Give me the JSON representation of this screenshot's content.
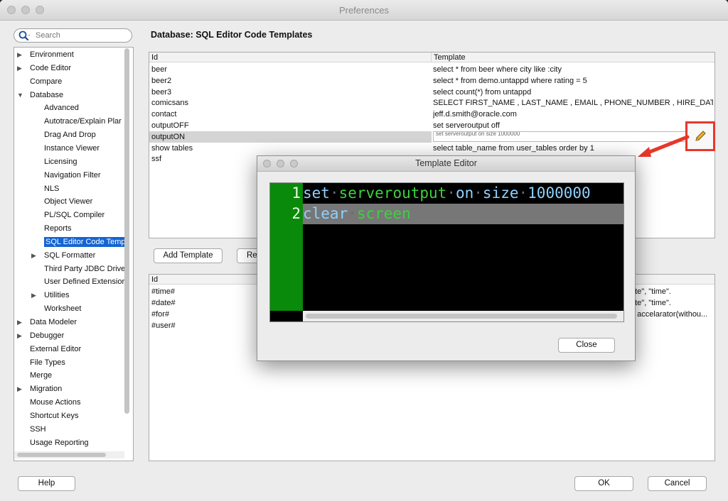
{
  "window": {
    "title": "Preferences"
  },
  "search": {
    "placeholder": "Search"
  },
  "tree": {
    "items": [
      {
        "label": "Environment",
        "expandable": true,
        "expanded": false,
        "level": 0
      },
      {
        "label": "Code Editor",
        "expandable": true,
        "expanded": false,
        "level": 0
      },
      {
        "label": "Compare",
        "expandable": false,
        "level": 0
      },
      {
        "label": "Database",
        "expandable": true,
        "expanded": true,
        "level": 0
      },
      {
        "label": "Advanced",
        "expandable": false,
        "level": 1
      },
      {
        "label": "Autotrace/Explain Plar",
        "expandable": false,
        "level": 1
      },
      {
        "label": "Drag And Drop",
        "expandable": false,
        "level": 1
      },
      {
        "label": "Instance Viewer",
        "expandable": false,
        "level": 1
      },
      {
        "label": "Licensing",
        "expandable": false,
        "level": 1
      },
      {
        "label": "Navigation Filter",
        "expandable": false,
        "level": 1
      },
      {
        "label": "NLS",
        "expandable": false,
        "level": 1
      },
      {
        "label": "Object Viewer",
        "expandable": false,
        "level": 1
      },
      {
        "label": "PL/SQL Compiler",
        "expandable": false,
        "level": 1
      },
      {
        "label": "Reports",
        "expandable": false,
        "level": 1
      },
      {
        "label": "SQL Editor Code Templ",
        "expandable": false,
        "level": 1,
        "selected": true
      },
      {
        "label": "SQL Formatter",
        "expandable": true,
        "expanded": false,
        "level": 1
      },
      {
        "label": "Third Party JDBC Driver",
        "expandable": false,
        "level": 1
      },
      {
        "label": "User Defined Extensior",
        "expandable": false,
        "level": 1
      },
      {
        "label": "Utilities",
        "expandable": true,
        "expanded": false,
        "level": 1
      },
      {
        "label": "Worksheet",
        "expandable": false,
        "level": 1
      },
      {
        "label": "Data Modeler",
        "expandable": true,
        "expanded": false,
        "level": 0
      },
      {
        "label": "Debugger",
        "expandable": true,
        "expanded": false,
        "level": 0
      },
      {
        "label": "External Editor",
        "expandable": false,
        "level": 0
      },
      {
        "label": "File Types",
        "expandable": false,
        "level": 0
      },
      {
        "label": "Merge",
        "expandable": false,
        "level": 0
      },
      {
        "label": "Migration",
        "expandable": true,
        "expanded": false,
        "level": 0
      },
      {
        "label": "Mouse Actions",
        "expandable": false,
        "level": 0
      },
      {
        "label": "Shortcut Keys",
        "expandable": false,
        "level": 0
      },
      {
        "label": "SSH",
        "expandable": false,
        "level": 0
      },
      {
        "label": "Usage Reporting",
        "expandable": false,
        "level": 0
      }
    ]
  },
  "panel": {
    "title": "Database: SQL Editor Code Templates",
    "templates_table": {
      "headers": [
        "Id",
        "Template"
      ],
      "rows": [
        {
          "id": "beer",
          "template": "select * from beer where city like :city"
        },
        {
          "id": "beer2",
          "template": "select * from demo.untappd where rating = 5"
        },
        {
          "id": "beer3",
          "template": "select count(*) from untappd"
        },
        {
          "id": "comicsans",
          "template": "SELECT FIRST_NAME , LAST_NAME , EMAIL , PHONE_NUMBER , HIRE_DATE , JOB_ID..."
        },
        {
          "id": "contact",
          "template": "jeff.d.smith@oracle.com"
        },
        {
          "id": "outputOFF",
          "template": "set serveroutput off"
        },
        {
          "id": "outputON",
          "template": "set serveroutput on size 1000000",
          "selected": true
        },
        {
          "id": "show tables",
          "template": "select table_name from user_tables order by 1"
        },
        {
          "id": "ssf",
          "template": ""
        }
      ]
    },
    "add_template_label": "Add Template",
    "remove_template_label": "Re",
    "vars_table": {
      "headers": [
        "Id"
      ],
      "rows": [
        {
          "id": "#time#",
          "tail": "ate\", \"time\"."
        },
        {
          "id": "#date#",
          "tail": "ate\", \"time\"."
        },
        {
          "id": "#for#",
          "tail": "e accelarator(withou..."
        },
        {
          "id": "#user#",
          "tail": ""
        }
      ]
    }
  },
  "dialog": {
    "title": "Template Editor",
    "lines": [
      {
        "number": "1",
        "tokens": [
          {
            "t": "set",
            "c": "kw"
          },
          {
            "t": "·",
            "c": "ws"
          },
          {
            "t": "serveroutput",
            "c": "gr"
          },
          {
            "t": "·",
            "c": "ws"
          },
          {
            "t": "on",
            "c": "kw"
          },
          {
            "t": "·",
            "c": "ws"
          },
          {
            "t": "size",
            "c": "kw"
          },
          {
            "t": "·",
            "c": "ws"
          },
          {
            "t": "1000000",
            "c": "kw"
          }
        ]
      },
      {
        "number": "2",
        "tokens": [
          {
            "t": "clear",
            "c": "kw"
          },
          {
            "t": "·",
            "c": "ws"
          },
          {
            "t": "screen",
            "c": "gr"
          }
        ]
      }
    ],
    "close_label": "Close"
  },
  "footer": {
    "help_label": "Help",
    "ok_label": "OK",
    "cancel_label": "Cancel"
  },
  "colors": {
    "selection": "#1464d2",
    "gutter": "#0a8a0a",
    "annotation": "#e8372a"
  },
  "icons": {
    "search": "magnifier-icon",
    "edit": "pencil-icon"
  }
}
